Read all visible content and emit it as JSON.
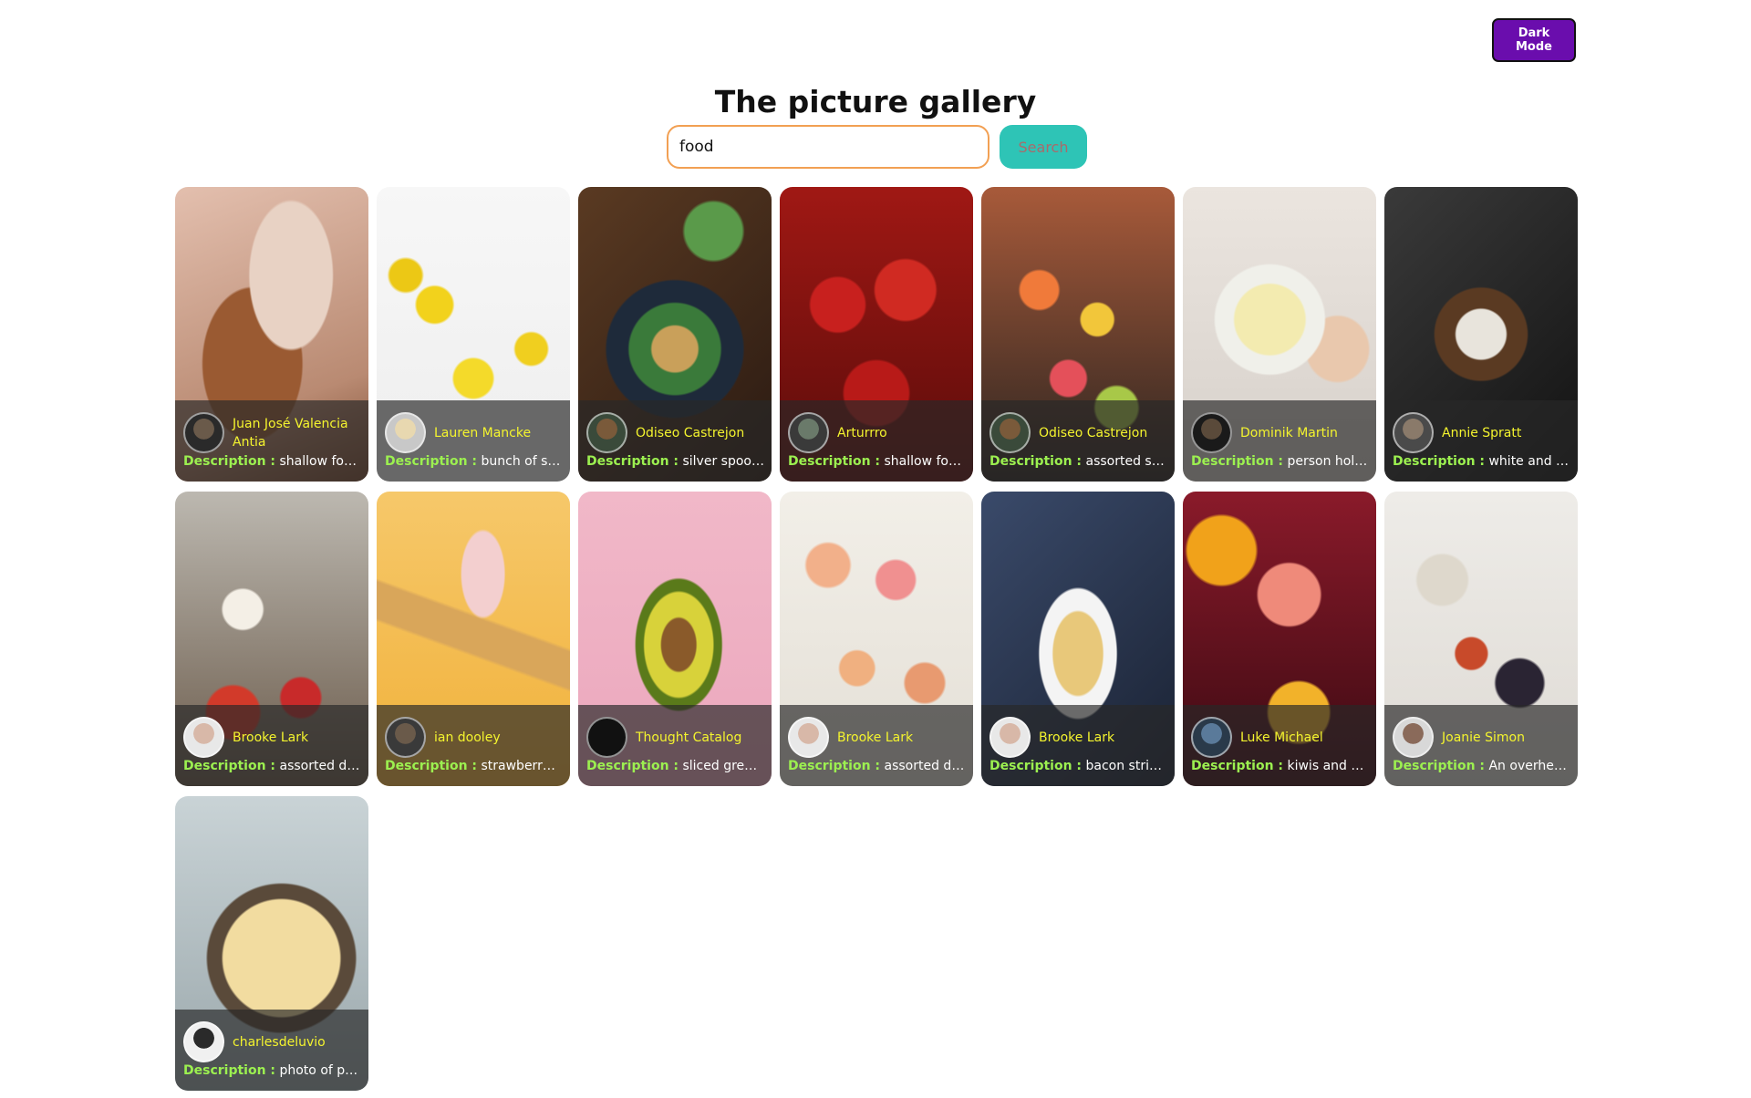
{
  "header": {
    "dark_mode_label": "Dark Mode",
    "title": "The picture gallery"
  },
  "search": {
    "value": "food",
    "button_label": "Search"
  },
  "desc_label": "Description :",
  "cards": [
    {
      "author": "Juan José Valencia Antia",
      "description": "shallow focus...",
      "photo": "almonds"
    },
    {
      "author": "Lauren Mancke",
      "description": "bunch of slice...",
      "photo": "lemons"
    },
    {
      "author": "Odiseo Castrejon",
      "description": "silver spoon o...",
      "photo": "salad-bowl"
    },
    {
      "author": "Arturrro",
      "description": "shallow focus...",
      "photo": "strawberries"
    },
    {
      "author": "Odiseo Castrejon",
      "description": "assorted slice...",
      "photo": "citrus-slices"
    },
    {
      "author": "Dominik Martin",
      "description": "person holdin...",
      "photo": "tea-bowl"
    },
    {
      "author": "Annie Spratt",
      "description": "white and bro...",
      "photo": "dessert"
    },
    {
      "author": "Brooke Lark",
      "description": "assorted drin...",
      "photo": "drinks"
    },
    {
      "author": "ian dooley",
      "description": "strawberry ic...",
      "photo": "ice-cream"
    },
    {
      "author": "Thought Catalog",
      "description": "sliced green ...",
      "photo": "avocado"
    },
    {
      "author": "Brooke Lark",
      "description": "assorted don...",
      "photo": "donuts"
    },
    {
      "author": "Brooke Lark",
      "description": "bacon strips ...",
      "photo": "pasta"
    },
    {
      "author": "Luke Michael",
      "description": "kiwis and ora...",
      "photo": "fruits"
    },
    {
      "author": "Joanie Simon",
      "description": "An overhead ...",
      "photo": "spices"
    },
    {
      "author": "charlesdeluvio",
      "description": "photo of pop...",
      "photo": "popcorn"
    }
  ],
  "colors": {
    "accent": "#6a0dad",
    "search_button": "#2ec4b6",
    "author_text": "#f4f42e",
    "desc_label": "#9cf050",
    "input_border": "#f2a053"
  }
}
